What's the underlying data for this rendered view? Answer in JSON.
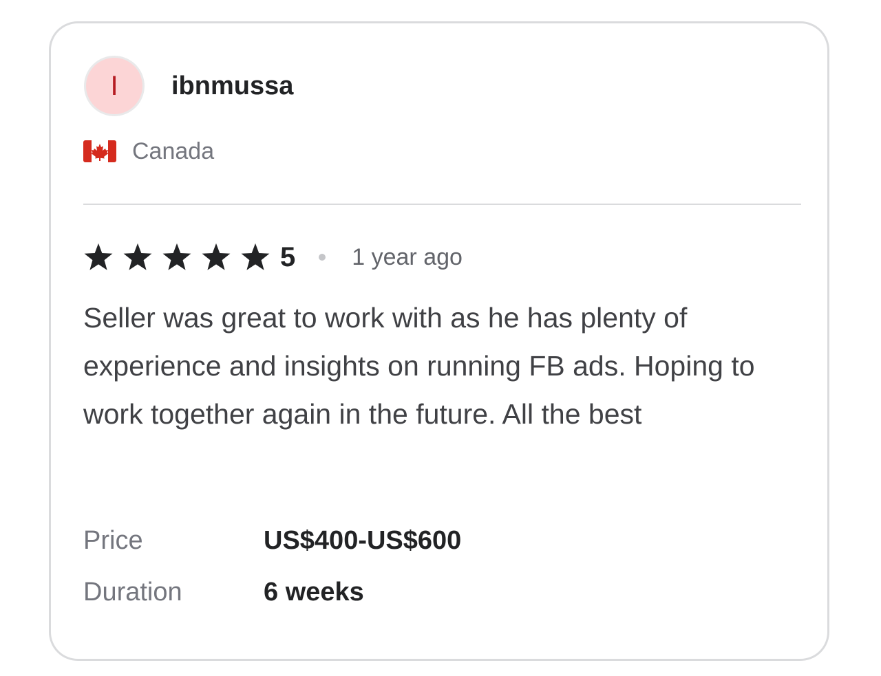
{
  "reviewer": {
    "avatar_initial": "I",
    "username": "ibnmussa",
    "country": "Canada",
    "flag_icon": "canada-flag-icon"
  },
  "review": {
    "rating": "5",
    "stars_filled": 5,
    "time_ago": "1 year ago",
    "text": "Seller was great to work with as he has plenty of experience and insights on running FB ads. Hoping to work together again in the future. All the best"
  },
  "details": {
    "price_label": "Price",
    "price_value": "US$400-US$600",
    "duration_label": "Duration",
    "duration_value": "6 weeks"
  },
  "colors": {
    "avatar_bg": "#fcd5d6",
    "avatar_text": "#b51c22",
    "star": "#222325",
    "flag_red": "#d52b1e"
  }
}
